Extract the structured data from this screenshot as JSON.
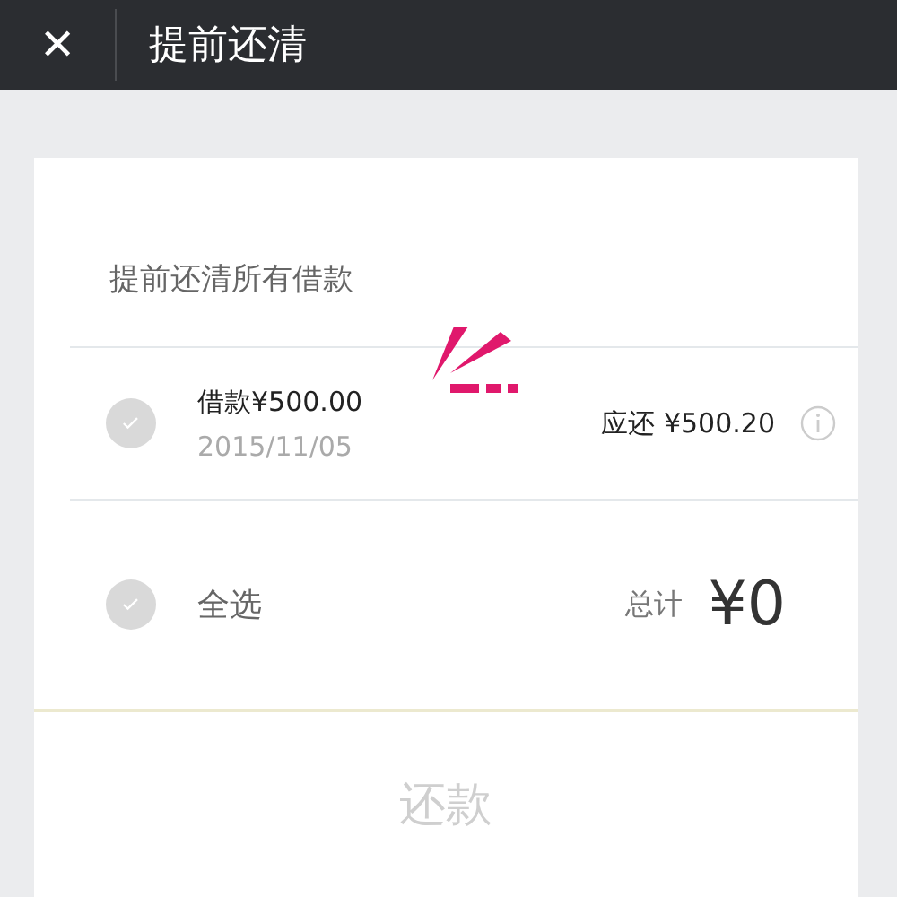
{
  "header": {
    "close": "✕",
    "title": "提前还清"
  },
  "section_title": "提前还清所有借款",
  "loans": [
    {
      "amount": "借款¥500.00",
      "date": "2015/11/05",
      "due": "应还 ¥500.20",
      "checked": false
    }
  ],
  "footer": {
    "select_all": {
      "label": "全选",
      "checked": false
    },
    "total_label": "总计",
    "total": "¥0"
  },
  "repay_button": {
    "label": "还款",
    "disabled": true
  }
}
